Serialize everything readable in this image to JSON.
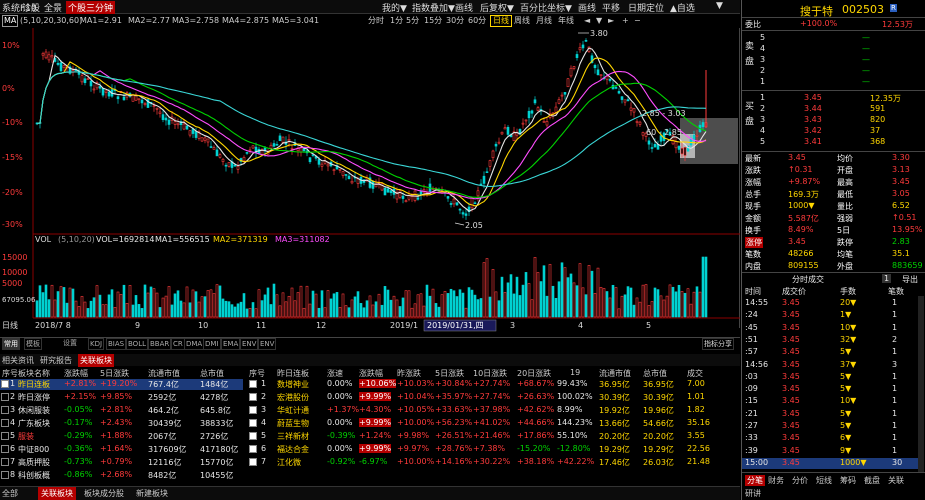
{
  "topbar": {
    "items": [
      "系统F10",
      "诊股",
      "全景",
      "个股三分钟"
    ],
    "right": [
      "我的▼",
      "指数叠加▼",
      "画线",
      "后复权▼",
      "百分比坐标▼",
      "画线",
      "平移",
      "日期定位",
      "▲自选",
      "▼"
    ]
  },
  "toolbar": {
    "ma_indicator": "MA",
    "ma_params": "(5,10,20,30,60)",
    "ma_values": [
      "MA1=2.91",
      "MA2=2.77",
      "MA3=2.758",
      "MA4=2.875",
      "MA5=3.041"
    ],
    "periods": [
      "分时",
      "1分",
      "5分",
      "15分",
      "30分",
      "60分",
      "日线",
      "周线",
      "月线",
      "年线",
      "◄",
      "▼",
      "►",
      "+",
      "−"
    ]
  },
  "chart": {
    "y_labels": [
      "10%",
      "0%",
      "-10%",
      "-15%",
      "-20%",
      "-30%"
    ],
    "high_label": "3.80",
    "low_label": "2.05",
    "annot1": "2.85 - 3.03",
    "annot2": "60 - 2.85",
    "vol_header": "VOL",
    "vol_params": "(5,10,20)",
    "vol_values": [
      "VOL=1692814",
      "MA1=556515",
      "MA2=371319",
      "MA3=311082"
    ],
    "vol_y_labels": [
      "15000",
      "10000",
      "5000",
      "67095.06"
    ],
    "x_labels": [
      "2018/7 8",
      "9",
      "10",
      "11",
      "12",
      "2019/1",
      "3",
      "4",
      "5"
    ],
    "x_highlight": "2019/01/31,四",
    "x_left_btn": "日线"
  },
  "subtabs": [
    "常用",
    "模板",
    "设置",
    "KDJ",
    "BIAS",
    "BOLL",
    "BBAR",
    "CR",
    "DMA",
    "DMI",
    "EMA",
    "ENV",
    "ENV"
  ],
  "sub_right": "指标分享",
  "bottomtabs": [
    "相关资讯",
    "研究报告",
    "关联板块"
  ],
  "left_table": {
    "headers": [
      "序号",
      "板块名称",
      "涨跌幅",
      "5日涨跌",
      "流通市值",
      "总市值"
    ],
    "rows": [
      [
        "1",
        "昨日连板",
        "+2.81%",
        "+19.20%",
        "767.4亿",
        "1484亿"
      ],
      [
        "2",
        "昨日涨停",
        "+2.15%",
        "+9.85%",
        "2592亿",
        "4278亿"
      ],
      [
        "3",
        "休闲服装",
        "-0.05%",
        "+2.81%",
        "464.2亿",
        "645.8亿"
      ],
      [
        "4",
        "广东板块",
        "-0.17%",
        "+2.43%",
        "30439亿",
        "38833亿"
      ],
      [
        "5",
        "服装",
        "-0.29%",
        "+1.88%",
        "2067亿",
        "2726亿"
      ],
      [
        "6",
        "中证800",
        "-0.36%",
        "+1.64%",
        "317609亿",
        "417180亿"
      ],
      [
        "7",
        "高质押股",
        "-0.73%",
        "+0.79%",
        "12116亿",
        "15770亿"
      ],
      [
        "8",
        "科创板概",
        "-0.86%",
        "+2.68%",
        "8482亿",
        "10455亿"
      ]
    ]
  },
  "right_table": {
    "headers": [
      "序号",
      "昨日连板",
      "涨速",
      "涨跌幅",
      "昨涨跌",
      "5日涨跌",
      "10日涨跌",
      "20日涨跌",
      "19",
      "流通市值",
      "总市值",
      "成交"
    ],
    "rows": [
      [
        "1",
        "数增神业",
        "0.00%",
        "+10.06%",
        "+10.03%",
        "+30.84%",
        "+27.74%",
        "+68.67%",
        "99.43%",
        "36.95亿",
        "36.95亿",
        "7.00"
      ],
      [
        "2",
        "宏港股份",
        "0.00%",
        "+9.99%",
        "+10.04%",
        "+35.97%",
        "+27.74%",
        "+26.63%",
        "100.02%",
        "30.39亿",
        "30.39亿",
        "1.01"
      ],
      [
        "3",
        "华虹计通",
        "+1.37%",
        "+4.30%",
        "+10.05%",
        "+33.63%",
        "+37.98%",
        "+42.62%",
        "8.99%",
        "19.92亿",
        "19.96亿",
        "1.82"
      ],
      [
        "4",
        "蔚蓝生物",
        "0.00%",
        "+9.99%",
        "+10.00%",
        "+56.23%",
        "+41.02%",
        "+44.66%",
        "144.23%",
        "13.66亿",
        "54.66亿",
        "35.16"
      ],
      [
        "5",
        "三祥新材",
        "-0.39%",
        "+1.24%",
        "+9.98%",
        "+26.51%",
        "+21.46%",
        "+17.86%",
        "55.10%",
        "20.20亿",
        "20.20亿",
        "3.55"
      ],
      [
        "6",
        "福达合金",
        "0.00%",
        "+9.99%",
        "+9.97%",
        "+28.76%",
        "+7.38%",
        "-15.20%",
        "-12.80%",
        "19.29亿",
        "19.29亿",
        "22.56"
      ],
      [
        "7",
        "江化微",
        "-0.92%",
        "-6.97%",
        "+10.00%",
        "+14.16%",
        "+30.22%",
        "+38.18%",
        "+42.22%",
        "17.46亿",
        "26.03亿",
        "21.48"
      ]
    ]
  },
  "statusbar": [
    "全部",
    "关联板块",
    "板块成分股",
    "新建板块"
  ],
  "quote": {
    "title": "搜于特",
    "code": "002503",
    "badge": "R",
    "wei_label": "委比",
    "wei_val": "+100.0%",
    "wei_diff": "12.53万",
    "sell_label": "卖盘",
    "sells": [
      [
        "5",
        "",
        ""
      ],
      [
        "4",
        "",
        ""
      ],
      [
        "3",
        "",
        ""
      ],
      [
        "2",
        "",
        ""
      ],
      [
        "1",
        "",
        ""
      ]
    ],
    "buy_label": "买盘",
    "buys": [
      [
        "1",
        "3.45",
        "12.35万"
      ],
      [
        "2",
        "3.44",
        "591"
      ],
      [
        "3",
        "3.43",
        "820"
      ],
      [
        "4",
        "3.42",
        "37"
      ],
      [
        "5",
        "3.41",
        "368"
      ]
    ],
    "stats": [
      [
        "最新",
        "3.45",
        "均价",
        "3.30"
      ],
      [
        "涨跌",
        "↑0.31",
        "开盘",
        "3.13"
      ],
      [
        "涨幅",
        "+9.87%",
        "最高",
        "3.45"
      ],
      [
        "总手",
        "169.3万",
        "最低",
        "3.05"
      ],
      [
        "现手",
        "1000▼",
        "量比",
        "6.52"
      ],
      [
        "金额",
        "5.587亿",
        "强弱",
        "↑0.51"
      ],
      [
        "换手",
        "8.49%",
        "5日",
        "13.95%"
      ],
      [
        "涨停",
        "3.45",
        "跌停",
        "2.83"
      ],
      [
        "笔数",
        "48266",
        "均笔",
        "35.1"
      ],
      [
        "内盘",
        "809155",
        "外盘",
        "883659"
      ]
    ],
    "trade_tabs": [
      "分时成交",
      "1",
      "导出"
    ],
    "trade_headers": [
      "时间",
      "成交价",
      "手数",
      "笔数"
    ],
    "trades": [
      [
        "14:55",
        "3.45",
        "20▼",
        "1"
      ],
      [
        ":24",
        "3.45",
        "1▼",
        "1"
      ],
      [
        ":45",
        "3.45",
        "10▼",
        "1"
      ],
      [
        ":51",
        "3.45",
        "32▼",
        "2"
      ],
      [
        ":57",
        "3.45",
        "5▼",
        "1"
      ],
      [
        "14:56",
        "3.45",
        "37▼",
        "3"
      ],
      [
        ":03",
        "3.45",
        "5▼",
        "1"
      ],
      [
        ":09",
        "3.45",
        "5▼",
        "1"
      ],
      [
        ":15",
        "3.45",
        "10▼",
        "1"
      ],
      [
        ":21",
        "3.45",
        "5▼",
        "1"
      ],
      [
        ":27",
        "3.45",
        "5▼",
        "1"
      ],
      [
        ":33",
        "3.45",
        "6▼",
        "1"
      ],
      [
        ":39",
        "3.45",
        "9▼",
        "1"
      ],
      [
        "15:00",
        "3.45",
        "1000▼",
        "30"
      ]
    ],
    "bottom_tabs": [
      "分笔",
      "财务",
      "分价",
      "短线",
      "筹码",
      "截盘",
      "关联",
      "研讲"
    ]
  },
  "colors": {
    "up": "#ff3b3b",
    "down": "#00d200",
    "ma1": "#e6e6e6",
    "ma2": "#ffd700",
    "ma3": "#ff4dff",
    "ma4": "#00d200",
    "ma5": "#3ad6d6"
  }
}
